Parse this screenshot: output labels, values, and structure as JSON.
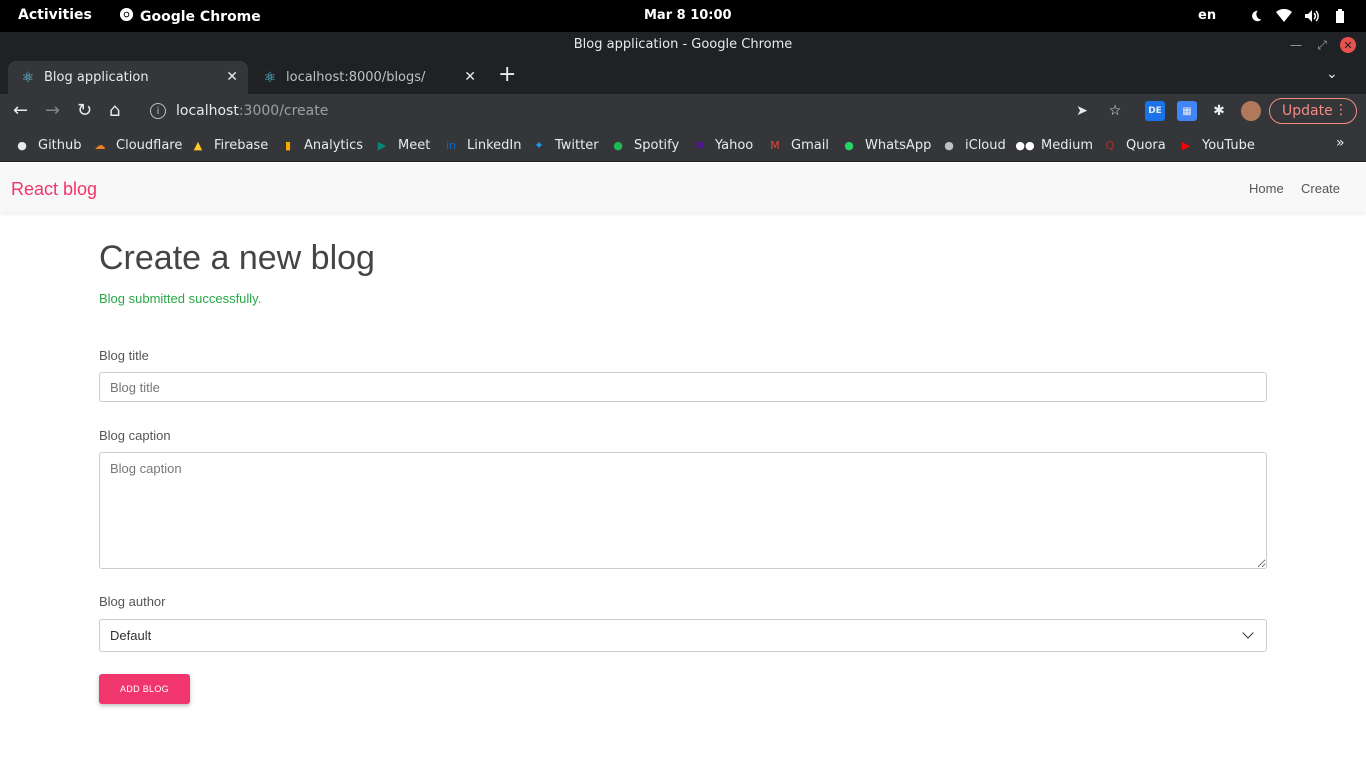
{
  "system": {
    "activities": "Activities",
    "app_name": "Google Chrome",
    "clock": "Mar 8 10:00",
    "language": "en"
  },
  "browser": {
    "window_title": "Blog application - Google Chrome",
    "tabs": [
      {
        "label": "Blog application",
        "active": true
      },
      {
        "label": "localhost:8000/blogs/",
        "active": false
      }
    ],
    "url_host": "localhost",
    "url_path": ":3000/create",
    "update_label": "Update",
    "bookmarks": [
      {
        "label": "Github",
        "icon": "github-icon",
        "color": "#e8eaed"
      },
      {
        "label": "Cloudflare",
        "icon": "cloudflare-icon",
        "color": "#f38020"
      },
      {
        "label": "Firebase",
        "icon": "firebase-icon",
        "color": "#ffca28"
      },
      {
        "label": "Analytics",
        "icon": "analytics-icon",
        "color": "#f9ab00"
      },
      {
        "label": "Meet",
        "icon": "meet-icon",
        "color": "#00897b"
      },
      {
        "label": "LinkedIn",
        "icon": "linkedin-icon",
        "color": "#0a66c2"
      },
      {
        "label": "Twitter",
        "icon": "twitter-icon",
        "color": "#1da1f2"
      },
      {
        "label": "Spotify",
        "icon": "spotify-icon",
        "color": "#1db954"
      },
      {
        "label": "Yahoo",
        "icon": "yahoo-icon",
        "color": "#6001d2"
      },
      {
        "label": "Gmail",
        "icon": "gmail-icon",
        "color": "#ea4335"
      },
      {
        "label": "WhatsApp",
        "icon": "whatsapp-icon",
        "color": "#25d366"
      },
      {
        "label": "iCloud",
        "icon": "apple-icon",
        "color": "#bdc1c6"
      },
      {
        "label": "Medium",
        "icon": "medium-icon",
        "color": "#ffffff"
      },
      {
        "label": "Quora",
        "icon": "quora-icon",
        "color": "#b92b27"
      },
      {
        "label": "YouTube",
        "icon": "youtube-icon",
        "color": "#ff0000"
      }
    ]
  },
  "app": {
    "brand": "React blog",
    "nav": {
      "home": "Home",
      "create": "Create"
    },
    "heading": "Create a new blog",
    "success_message": "Blog submitted successfully.",
    "form": {
      "title_label": "Blog title",
      "title_placeholder": "Blog title",
      "caption_label": "Blog caption",
      "caption_placeholder": "Blog caption",
      "author_label": "Blog author",
      "author_value": "Default",
      "submit_label": "ADD BLOG"
    },
    "accent_color": "#f1356d",
    "success_color": "#28a745"
  }
}
